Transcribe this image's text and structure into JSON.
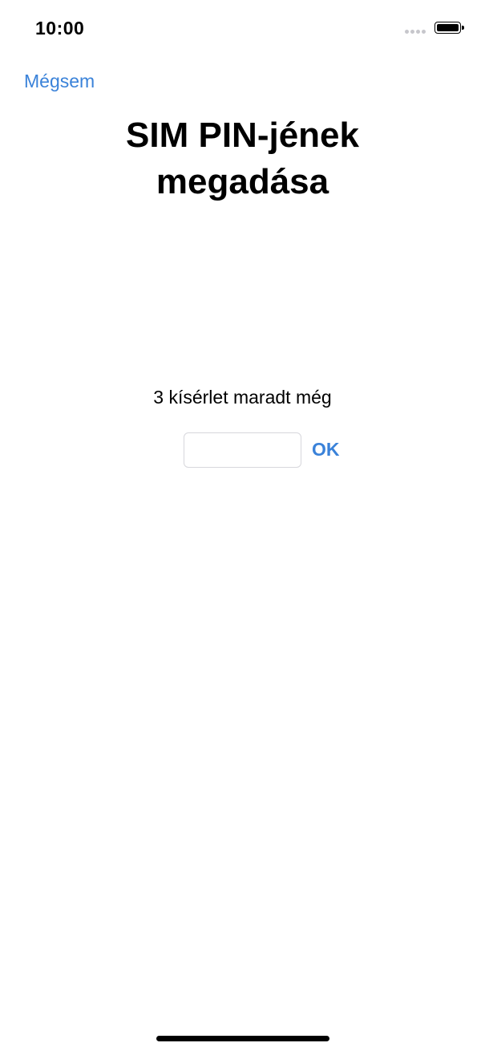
{
  "status_bar": {
    "time": "10:00",
    "signal_icon": "signal-dots-icon",
    "battery_icon": "battery-full-icon",
    "battery_level": 1.0
  },
  "nav": {
    "cancel_label": "Mégsem"
  },
  "title": {
    "line1": "SIM PIN-jének",
    "line2": "megadása"
  },
  "attempts_text": "3 kísérlet maradt még",
  "pin": {
    "value": "",
    "placeholder": ""
  },
  "ok_label": "OK",
  "colors": {
    "accent": "#3a82d9",
    "text": "#000000",
    "background": "#ffffff"
  }
}
